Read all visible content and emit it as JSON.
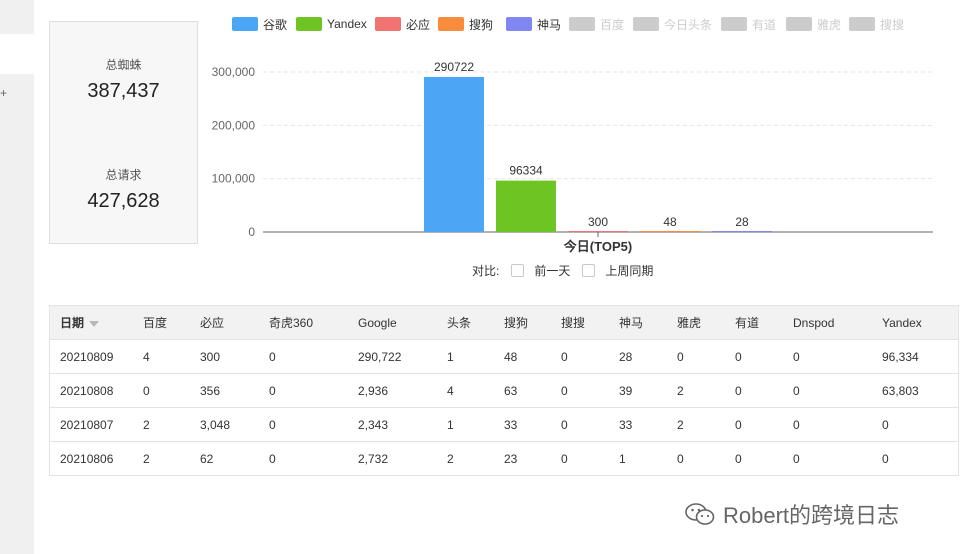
{
  "sidebar": {
    "edge_glyph": "+"
  },
  "stats": {
    "spiders_label": "总蜘蛛",
    "spiders_value": "387,437",
    "requests_label": "总请求",
    "requests_value": "427,628"
  },
  "legend": {
    "items": [
      {
        "label": "谷歌",
        "color": "#4da6f5",
        "active": true
      },
      {
        "label": "Yandex",
        "color": "#6ec422",
        "active": true
      },
      {
        "label": "必应",
        "color": "#f07371",
        "active": true
      },
      {
        "label": "搜狗",
        "color": "#f98c3c",
        "active": true
      },
      {
        "label": "神马",
        "color": "#8087f2",
        "active": true
      },
      {
        "label": "百度",
        "color": "#cccccc",
        "active": false
      },
      {
        "label": "今日头条",
        "color": "#cccccc",
        "active": false
      },
      {
        "label": "有道",
        "color": "#cccccc",
        "active": false
      },
      {
        "label": "雅虎",
        "color": "#cccccc",
        "active": false
      },
      {
        "label": "搜搜",
        "color": "#cccccc",
        "active": false
      }
    ]
  },
  "chart_data": {
    "type": "bar",
    "categories": [
      "今日(TOP5)"
    ],
    "xlabel": "今日(TOP5)",
    "ylim": [
      0,
      300000
    ],
    "yticks": [
      "300,000",
      "200,000",
      "100,000",
      "0"
    ],
    "ytick_values": [
      300000,
      200000,
      100000,
      0
    ],
    "grid": true,
    "series": [
      {
        "name": "谷歌",
        "values": [
          290722
        ],
        "color": "#4da6f5"
      },
      {
        "name": "Yandex",
        "values": [
          96334
        ],
        "color": "#6ec422"
      },
      {
        "name": "必应",
        "values": [
          300
        ],
        "color": "#f07371"
      },
      {
        "name": "搜狗",
        "values": [
          48
        ],
        "color": "#f98c3c"
      },
      {
        "name": "神马",
        "values": [
          28
        ],
        "color": "#8087f2"
      }
    ]
  },
  "compare": {
    "label": "对比:",
    "options": [
      "前一天",
      "上周同期"
    ]
  },
  "table": {
    "headers": [
      "日期",
      "百度",
      "必应",
      "奇虎360",
      "Google",
      "头条",
      "搜狗",
      "搜搜",
      "神马",
      "雅虎",
      "有道",
      "Dnspod",
      "Yandex"
    ],
    "rows": [
      [
        "20210809",
        "4",
        "300",
        "0",
        "290,722",
        "1",
        "48",
        "0",
        "28",
        "0",
        "0",
        "0",
        "96,334"
      ],
      [
        "20210808",
        "0",
        "356",
        "0",
        "2,936",
        "4",
        "63",
        "0",
        "39",
        "2",
        "0",
        "0",
        "63,803"
      ],
      [
        "20210807",
        "2",
        "3,048",
        "0",
        "2,343",
        "1",
        "33",
        "0",
        "33",
        "2",
        "0",
        "0",
        "0"
      ],
      [
        "20210806",
        "2",
        "62",
        "0",
        "2,732",
        "2",
        "23",
        "0",
        "1",
        "0",
        "0",
        "0",
        "0"
      ]
    ]
  },
  "watermark": {
    "text": "Robert的跨境日志"
  }
}
